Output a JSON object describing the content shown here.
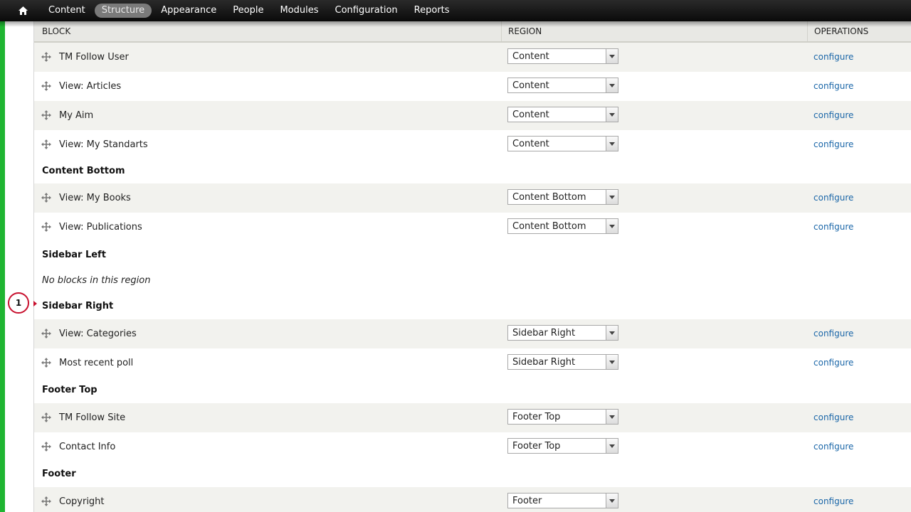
{
  "toolbar": {
    "home_icon": "home-icon",
    "items": [
      {
        "label": "Content",
        "active": false
      },
      {
        "label": "Structure",
        "active": true
      },
      {
        "label": "Appearance",
        "active": false
      },
      {
        "label": "People",
        "active": false
      },
      {
        "label": "Modules",
        "active": false
      },
      {
        "label": "Configuration",
        "active": false
      },
      {
        "label": "Reports",
        "active": false
      }
    ]
  },
  "table": {
    "headers": {
      "block": "BLOCK",
      "region": "REGION",
      "operations": "OPERATIONS"
    },
    "configure_label": "configure",
    "rows": [
      {
        "block": "TM Follow User",
        "region": "Content"
      },
      {
        "block": "View: Articles",
        "region": "Content"
      },
      {
        "block": "My Aim",
        "region": "Content"
      },
      {
        "block": "View: My Standarts",
        "region": "Content"
      },
      {
        "block": "View: My Books",
        "region": "Content Bottom"
      },
      {
        "block": "View: Publications",
        "region": "Content Bottom"
      },
      {
        "block": "View: Categories",
        "region": "Sidebar Right"
      },
      {
        "block": "Most recent poll",
        "region": "Sidebar Right"
      },
      {
        "block": "TM Follow Site",
        "region": "Footer Top"
      },
      {
        "block": "Contact Info",
        "region": "Footer Top"
      },
      {
        "block": "Copyright",
        "region": "Footer"
      }
    ],
    "region_titles": {
      "content_bottom": "Content Bottom",
      "sidebar_left": "Sidebar Left",
      "sidebar_right": "Sidebar Right",
      "footer_top": "Footer Top",
      "footer": "Footer"
    },
    "empty_region_message": "No blocks in this region"
  },
  "callout": {
    "label": "1"
  },
  "colors": {
    "toolbar_bg": "#111111",
    "accent": "#1fb531",
    "link": "#1a66a8",
    "callout_border": "#c8102e"
  }
}
